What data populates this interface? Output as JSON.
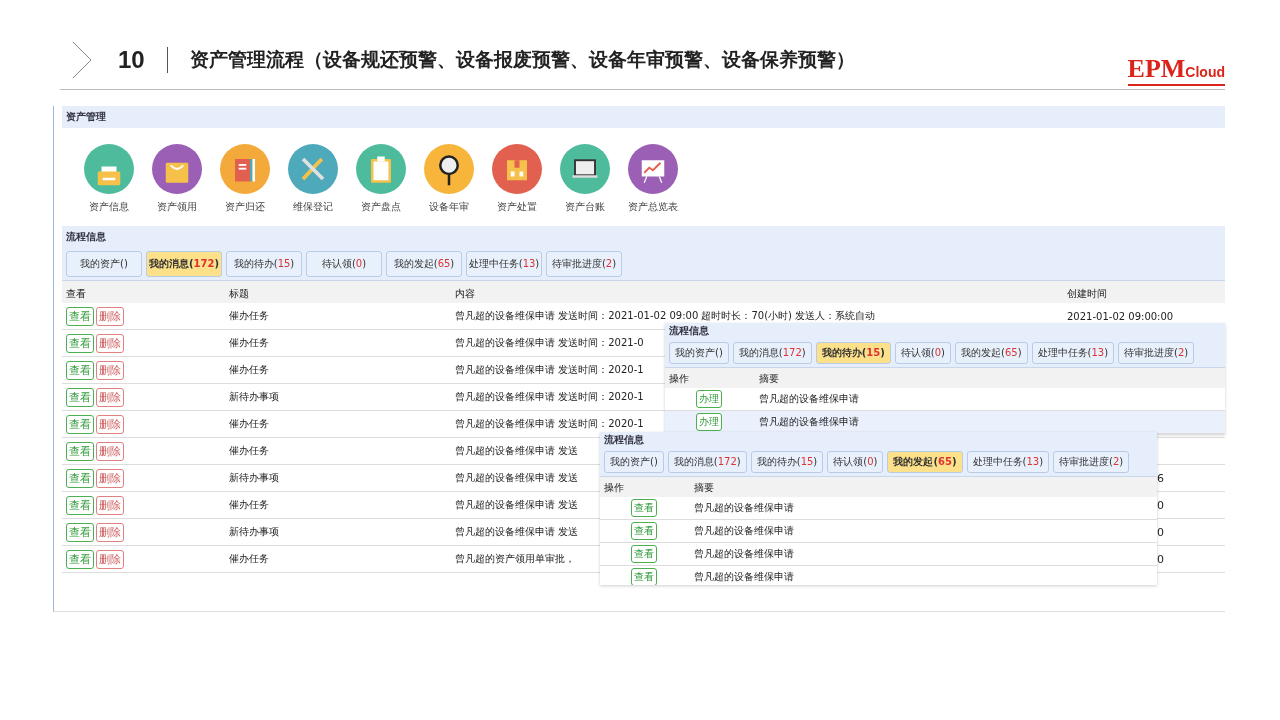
{
  "slide": {
    "number": "10",
    "title": "资产管理流程（设备规还预警、设备报废预警、设备年审预警、设备保养预警）",
    "logo": {
      "main": "EPM",
      "sub": "Cloud"
    }
  },
  "asset_panel": {
    "title": "资产管理",
    "modules": [
      {
        "label": "资产信息",
        "kind": "printer",
        "color": "#4dbb9c"
      },
      {
        "label": "资产领用",
        "kind": "bag",
        "color": "#9b5fb5"
      },
      {
        "label": "资产归还",
        "kind": "book",
        "color": "#f4a93b"
      },
      {
        "label": "维保登记",
        "kind": "tools",
        "color": "#4eaabb"
      },
      {
        "label": "资产盘点",
        "kind": "clipboard",
        "color": "#4dbb9c"
      },
      {
        "label": "设备年审",
        "kind": "magnifier",
        "color": "#f7b53c"
      },
      {
        "label": "资产处置",
        "kind": "box",
        "color": "#e2604f"
      },
      {
        "label": "资产台账",
        "kind": "laptop",
        "color": "#4dbb9c"
      },
      {
        "label": "资产总览表",
        "kind": "chart",
        "color": "#9b5fb5"
      }
    ]
  },
  "process_panel": {
    "title": "流程信息",
    "tabs": [
      {
        "label": "我的资产()",
        "selected": false
      },
      {
        "label": "我的消息(",
        "count": "172",
        "close": ")",
        "selected": true
      },
      {
        "label": "我的待办(",
        "count": "15",
        "close": ")",
        "selected": false
      },
      {
        "label": "待认领(",
        "count": "0",
        "close": ")",
        "selected": false
      },
      {
        "label": "我的发起(",
        "count": "65",
        "close": ")",
        "selected": false
      },
      {
        "label": "处理中任务(",
        "count": "13",
        "close": ")",
        "selected": false
      },
      {
        "label": "待审批进度(",
        "count": "2",
        "close": ")",
        "selected": false
      }
    ],
    "columns": [
      "查看",
      "标题",
      "内容",
      "创建时间"
    ],
    "rows": [
      {
        "view": "查看",
        "delete": "删除",
        "title": "催办任务",
        "content": "曾凡超的设备维保申请 发送时间：2021-01-02 09:00 超时时长：70(小时) 发送人：系统自动",
        "created": "2021-01-02 09:00:00"
      },
      {
        "view": "查看",
        "delete": "删除",
        "title": "催办任务",
        "content": "曾凡超的设备维保申请 发送时间：2021-0"
      },
      {
        "view": "查看",
        "delete": "删除",
        "title": "催办任务",
        "content": "曾凡超的设备维保申请 发送时间：2020-1"
      },
      {
        "view": "查看",
        "delete": "删除",
        "title": "新待办事项",
        "content": "曾凡超的设备维保申请 发送时间：2020-1"
      },
      {
        "view": "查看",
        "delete": "删除",
        "title": "催办任务",
        "content": "曾凡超的设备维保申请 发送时间：2020-1"
      },
      {
        "view": "查看",
        "delete": "删除",
        "title": "催办任务",
        "content": "曾凡超的设备维保申请 发送"
      },
      {
        "view": "查看",
        "delete": "删除",
        "title": "新待办事项",
        "content": "曾凡超的设备维保申请 发送",
        "created": "6"
      },
      {
        "view": "查看",
        "delete": "删除",
        "title": "催办任务",
        "content": "曾凡超的设备维保申请 发送",
        "created": "0"
      },
      {
        "view": "查看",
        "delete": "删除",
        "title": "新待办事项",
        "content": "曾凡超的设备维保申请 发送",
        "created": "0"
      },
      {
        "view": "查看",
        "delete": "删除",
        "title": "催办任务",
        "content": "曾凡超的资产领用单审批，",
        "created": "0"
      }
    ]
  },
  "popups": [
    {
      "title": "流程信息",
      "tabs": [
        {
          "label": "我的资产()",
          "selected": false
        },
        {
          "label": "我的消息(",
          "count": "172",
          "close": ")",
          "selected": false
        },
        {
          "label": "我的待办(",
          "count": "15",
          "close": ")",
          "selected": true
        },
        {
          "label": "待认领(",
          "count": "0",
          "close": ")",
          "selected": false
        },
        {
          "label": "我的发起(",
          "count": "65",
          "close": ")",
          "selected": false
        },
        {
          "label": "处理中任务(",
          "count": "13",
          "close": ")",
          "selected": false
        },
        {
          "label": "待审批进度(",
          "count": "2",
          "close": ")",
          "selected": false
        }
      ],
      "columns": [
        "操作",
        "摘要"
      ],
      "rows": [
        {
          "action": "办理",
          "summary": "曾凡超的设备维保申请",
          "selected": false
        },
        {
          "action": "办理",
          "summary": "曾凡超的设备维保申请",
          "selected": true
        }
      ]
    },
    {
      "title": "流程信息",
      "tabs": [
        {
          "label": "我的资产()",
          "selected": false
        },
        {
          "label": "我的消息(",
          "count": "172",
          "close": ")",
          "selected": false
        },
        {
          "label": "我的待办(",
          "count": "15",
          "close": ")",
          "selected": false
        },
        {
          "label": "待认领(",
          "count": "0",
          "close": ")",
          "selected": false
        },
        {
          "label": "我的发起(",
          "count": "65",
          "close": ")",
          "selected": true
        },
        {
          "label": "处理中任务(",
          "count": "13",
          "close": ")",
          "selected": false
        },
        {
          "label": "待审批进度(",
          "count": "2",
          "close": ")",
          "selected": false
        }
      ],
      "columns": [
        "操作",
        "摘要"
      ],
      "rows": [
        {
          "action": "查看",
          "summary": "曾凡超的设备维保申请",
          "selected": false
        },
        {
          "action": "查看",
          "summary": "曾凡超的设备维保申请",
          "selected": false
        },
        {
          "action": "查看",
          "summary": "曾凡超的设备维保申请",
          "selected": false
        },
        {
          "action": "查看",
          "summary": "曾凡超的设备维保申请",
          "selected": false
        }
      ]
    }
  ]
}
